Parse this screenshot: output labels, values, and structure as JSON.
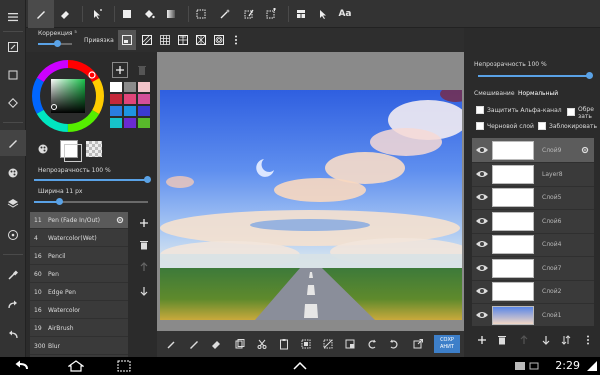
{
  "top_toolbar": {
    "text_tool_label": "Aa"
  },
  "sub_toolbar": {
    "correction_label": "Коррекция ⁵",
    "snap_label": "Привязка"
  },
  "left_panel": {
    "swatches": [
      "#ffffff",
      "#8a8a8a",
      "#f2c3c9",
      "#c4283a",
      "#e0457a",
      "#d44f9a",
      "#2a7de0",
      "#1e94e0",
      "#3a3ad0",
      "#17c2c9",
      "#6a2bd0",
      "#58b82b"
    ],
    "opacity_label": "Непрозрачность 100 %",
    "width_label": "Ширина 11 px"
  },
  "brushes": [
    {
      "size": "11",
      "name": "Pen (Fade In/Out)",
      "selected": true
    },
    {
      "size": "4",
      "name": "Watercolor(Wet)",
      "selected": false
    },
    {
      "size": "16",
      "name": "Pencil",
      "selected": false
    },
    {
      "size": "60",
      "name": "Pen",
      "selected": false
    },
    {
      "size": "10",
      "name": "Edge Pen",
      "selected": false
    },
    {
      "size": "16",
      "name": "Watercolor",
      "selected": false
    },
    {
      "size": "19",
      "name": "AirBrush",
      "selected": false
    },
    {
      "size": "300",
      "name": "Blur",
      "selected": false
    }
  ],
  "canvas_bar": {
    "save_label": "СОХР АНИТ"
  },
  "right_panel": {
    "opacity_label": "Непрозрачность 100 %",
    "blend_label": "Смешивание",
    "blend_value": "Нормальный",
    "alpha_label": "Защитить Альфа-канал",
    "clip_label": "Обре зать",
    "draft_label": "Черновой слой",
    "lock_label": "Заблокировать"
  },
  "layers": [
    {
      "name": "Слой9",
      "selected": true
    },
    {
      "name": "Layer8",
      "selected": false
    },
    {
      "name": "Слой5",
      "selected": false
    },
    {
      "name": "Слой6",
      "selected": false
    },
    {
      "name": "Слой4",
      "selected": false
    },
    {
      "name": "Слой7",
      "selected": false
    },
    {
      "name": "Слой2",
      "selected": false
    },
    {
      "name": "Слой1",
      "selected": false
    }
  ],
  "system_bar": {
    "clock": "2:29"
  },
  "colors": {
    "accent": "#5aa2e6",
    "save_button": "#3d7fc9"
  }
}
